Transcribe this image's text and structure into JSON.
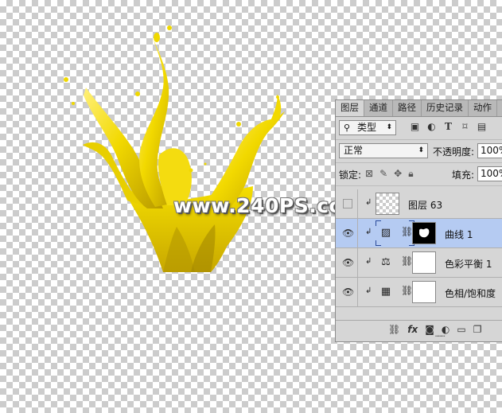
{
  "watermark": "www.240PS.com",
  "panel": {
    "tabs": [
      {
        "label": "图层",
        "active": true
      },
      {
        "label": "通道",
        "active": false
      },
      {
        "label": "路径",
        "active": false
      },
      {
        "label": "历史记录",
        "active": false
      },
      {
        "label": "动作",
        "active": false
      }
    ],
    "filter": {
      "label": "类型"
    },
    "blend_mode": "正常",
    "opacity_label": "不透明度:",
    "opacity_value": "100%",
    "lock_label": "锁定:",
    "fill_label": "填充:",
    "fill_value": "100%",
    "layers": [
      {
        "name": "图层 63",
        "visible": false,
        "selected": false
      },
      {
        "name": "曲线 1",
        "visible": true,
        "selected": true
      },
      {
        "name": "色彩平衡 1",
        "visible": true,
        "selected": false
      },
      {
        "name": "色相/饱和度",
        "visible": true,
        "selected": false
      }
    ],
    "footer_icons": [
      "link-icon",
      "fx-icon",
      "mask-icon",
      "adjustment-icon",
      "group-icon",
      "new-layer-icon"
    ]
  },
  "colors": {
    "accent_selected": "#b5cbf2",
    "paint_yellow": "#f0d800"
  }
}
